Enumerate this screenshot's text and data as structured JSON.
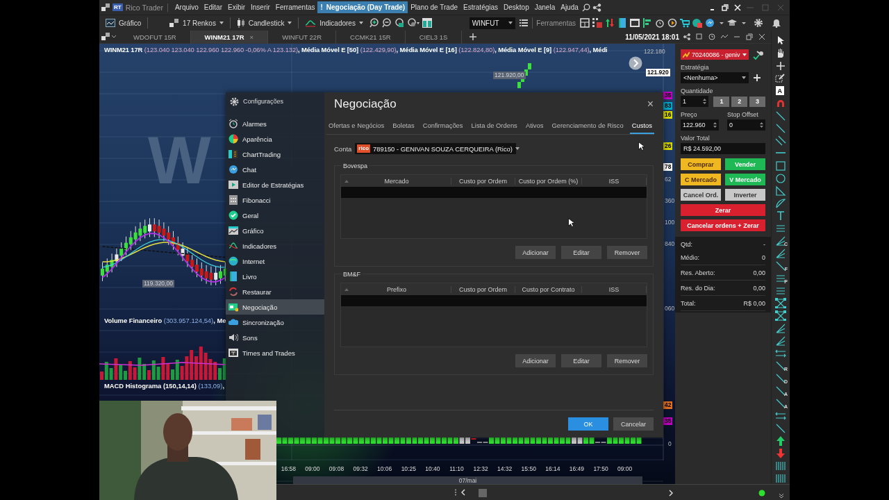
{
  "app": {
    "logo": "RT",
    "title": "Rico Trader"
  },
  "menu": [
    {
      "label": "Arquivo",
      "selected": false
    },
    {
      "label": "Editar",
      "selected": false
    },
    {
      "label": "Exibir",
      "selected": false
    },
    {
      "label": "Inserir",
      "selected": false
    },
    {
      "label": "Ferramentas",
      "selected": false
    },
    {
      "label": "Negociação (Day Trade)",
      "selected": true,
      "badge": "!"
    },
    {
      "label": "Plano de Trade",
      "selected": false
    },
    {
      "label": "Estratégias",
      "selected": false
    },
    {
      "label": "Desktop",
      "selected": false
    },
    {
      "label": "Janela",
      "selected": false
    },
    {
      "label": "Ajuda",
      "selected": false
    }
  ],
  "toolbar": {
    "chart_button": "Gráfico",
    "bricks": "17 Renkos",
    "style": "Candlestick",
    "indicators": "Indicadores",
    "symbol": "WINFUT",
    "tools_label": "Ferramentas"
  },
  "chart_tabs": [
    {
      "label": "WDOFUT 15R",
      "selected": false
    },
    {
      "label": "WINM21 17R",
      "selected": true,
      "close": "×"
    },
    {
      "label": "WINFUT 22R",
      "selected": false
    },
    {
      "label": "CCMK21 15R",
      "selected": false
    },
    {
      "label": "CIEL3 1S",
      "selected": false
    }
  ],
  "datetime": "11/05/2021 18:01",
  "chart": {
    "header": [
      {
        "text": "WINM21 17R ",
        "kind": "name"
      },
      {
        "text": "(123.040  123.040  122.960  122.960  -0,06%  A 123.132)",
        "kind": "value"
      },
      {
        "text": ", Média Móvel E [50] ",
        "kind": "name"
      },
      {
        "text": "(122.429,90)",
        "kind": "value"
      },
      {
        "text": ", Média Móvel E [16] ",
        "kind": "name"
      },
      {
        "text": "(122.824,80)",
        "kind": "value"
      },
      {
        "text": ", Média Móvel E [9] ",
        "kind": "name"
      },
      {
        "text": "(122.947,44)",
        "kind": "value"
      },
      {
        "text": ", Médi",
        "kind": "name"
      }
    ],
    "watermark": "W",
    "price_labels": [
      {
        "text": "122.180",
        "kind": "axis"
      },
      {
        "text": "121.920",
        "kind": "current"
      },
      {
        "text": "121.920,00",
        "kind": "marker"
      },
      {
        "text": "35",
        "kind": "badge",
        "color": "#c000c0"
      },
      {
        "text": "83",
        "kind": "badge",
        "color": "#00a8c8"
      },
      {
        "text": "16",
        "kind": "badge",
        "color": "#d8d800"
      },
      {
        "text": "26",
        "kind": "badge",
        "color": "#d8d800"
      },
      {
        "text": "78",
        "kind": "current"
      },
      {
        "text": "62",
        "kind": "axis"
      },
      {
        "text": "360",
        "kind": "axis"
      },
      {
        "text": "100",
        "kind": "axis"
      },
      {
        "text": "840",
        "kind": "axis"
      },
      {
        "text": "119.320,00",
        "kind": "marker"
      },
      {
        "text": "060",
        "kind": "axis"
      },
      {
        "text": "42",
        "kind": "badge",
        "color": "#e07020"
      },
      {
        "text": "35",
        "kind": "badge",
        "color": "#c000c0"
      },
      {
        "text": "0",
        "kind": "axis"
      }
    ],
    "volume_header": [
      {
        "text": "Volume Financeiro ",
        "kind": "name"
      },
      {
        "text": "(303.957.124,54)",
        "kind": "value"
      },
      {
        "text": ", Me",
        "kind": "name"
      }
    ],
    "macd_header": [
      {
        "text": "MACD Histograma (150,14,14) ",
        "kind": "name"
      },
      {
        "text": "(133,09)",
        "kind": "value"
      },
      {
        "text": ",",
        "kind": "name"
      }
    ],
    "time_labels": [
      "16:58",
      "09:00",
      "09:08",
      "09:32",
      "10:06",
      "10:25",
      "10:40",
      "11:10",
      "12:32",
      "14:32",
      "15:50",
      "16:14",
      "16:49",
      "17:50",
      "09:00"
    ],
    "date_band": "07/mai"
  },
  "dialog": {
    "sidebar_title": "Configurações",
    "sidebar": [
      {
        "label": "Alarmes",
        "selected": false
      },
      {
        "label": "Aparência",
        "selected": false
      },
      {
        "label": "ChartTrading",
        "selected": false
      },
      {
        "label": "Chat",
        "selected": false
      },
      {
        "label": "Editor de Estratégias",
        "selected": false
      },
      {
        "label": "Fibonacci",
        "selected": false
      },
      {
        "label": "Geral",
        "selected": false
      },
      {
        "label": "Gráfico",
        "selected": false
      },
      {
        "label": "Indicadores",
        "selected": false
      },
      {
        "label": "Internet",
        "selected": false
      },
      {
        "label": "Livro",
        "selected": false
      },
      {
        "label": "Restaurar",
        "selected": false
      },
      {
        "label": "Negociação",
        "selected": true
      },
      {
        "label": "Sincronização",
        "selected": false
      },
      {
        "label": "Sons",
        "selected": false
      },
      {
        "label": "Times and Trades",
        "selected": false
      }
    ],
    "title": "Negociação",
    "close": "×",
    "tabs": [
      {
        "label": "Ofertas e Negócios",
        "selected": false
      },
      {
        "label": "Boletas",
        "selected": false
      },
      {
        "label": "Confirmações",
        "selected": false
      },
      {
        "label": "Lista de Ordens",
        "selected": false
      },
      {
        "label": "Ativos",
        "selected": false
      },
      {
        "label": "Gerenciamento de Risco",
        "selected": false
      },
      {
        "label": "Custos",
        "selected": true
      }
    ],
    "account_label": "Conta",
    "account_logo": "rico",
    "account": "789150 - GENIVAN SOUZA CERQUEIRA (Rico)",
    "groups": [
      {
        "title": "Bovespa",
        "columns": [
          "Mercado",
          "Custo por Ordem",
          "Custo por Ordem (%)",
          "ISS"
        ],
        "buttons": [
          "Adicionar",
          "Editar",
          "Remover"
        ]
      },
      {
        "title": "BM&F",
        "columns": [
          "Prefixo",
          "Custo por Ordem",
          "Custo por Contrato",
          "ISS"
        ],
        "buttons": [
          "Adicionar",
          "Editar",
          "Remover"
        ]
      }
    ],
    "ok": "OK",
    "cancel": "Cancelar"
  },
  "order_panel": {
    "account": "70240086 - geniv",
    "strategy_label": "Estratégia",
    "strategy": "<Nenhuma>",
    "quantity_label": "Quantidade",
    "quantity": "1",
    "quick_quantities": [
      "1",
      "2",
      "3"
    ],
    "price_label": "Preço",
    "price": "122.960",
    "stop_label": "Stop Offset",
    "stop": "0",
    "total_label": "Valor Total",
    "total": "R$ 24.592,00",
    "buttons": [
      {
        "label": "Comprar",
        "kind": "buy"
      },
      {
        "label": "Vender",
        "kind": "sell"
      },
      {
        "label": "C Mercado",
        "kind": "buy"
      },
      {
        "label": "V Mercado",
        "kind": "sell"
      },
      {
        "label": "Cancel Ord.",
        "kind": "neutral"
      },
      {
        "label": "Inverter",
        "kind": "neutral"
      },
      {
        "label": "Zerar",
        "kind": "danger"
      },
      {
        "label": "Cancelar ordens + Zerar",
        "kind": "danger"
      }
    ],
    "summary": [
      {
        "label": "Qtd:",
        "value": "-"
      },
      {
        "label": "Médio:",
        "value": "0"
      },
      {
        "label": "Res. Aberto:",
        "value": "0,00"
      },
      {
        "label": "Res. do Dia:",
        "value": "0,00"
      },
      {
        "label": "Total:",
        "value": "R$ 0,00"
      }
    ]
  },
  "tools": [
    {
      "kind": "pointer"
    },
    {
      "kind": "hand"
    },
    {
      "kind": "plus"
    },
    {
      "kind": "edit"
    },
    {
      "kind": "textbox",
      "letter": "A"
    },
    {
      "kind": "magnet"
    },
    {
      "kind": "line"
    },
    {
      "kind": "line"
    },
    {
      "kind": "parallel"
    },
    {
      "kind": "hline"
    },
    {
      "kind": "rect"
    },
    {
      "kind": "circle"
    },
    {
      "kind": "triangle"
    },
    {
      "kind": "arc"
    },
    {
      "kind": "text"
    },
    {
      "kind": "lines"
    },
    {
      "kind": "fan",
      "letter": "C"
    },
    {
      "kind": "fan"
    },
    {
      "kind": "line",
      "letter": "F"
    },
    {
      "kind": "lines",
      "letter": "P"
    },
    {
      "kind": "lines"
    },
    {
      "kind": "nodes"
    },
    {
      "kind": "nodes"
    },
    {
      "kind": "fan"
    },
    {
      "kind": "fan"
    },
    {
      "kind": "arrows"
    },
    {
      "kind": "line",
      "letter": "R"
    },
    {
      "kind": "line",
      "letter": "D"
    },
    {
      "kind": "line",
      "letter": "A"
    },
    {
      "kind": "line",
      "letter": "A"
    },
    {
      "kind": "arrows"
    },
    {
      "kind": "line"
    },
    {
      "kind": "up"
    },
    {
      "kind": "down"
    },
    {
      "kind": "bars"
    },
    {
      "kind": "bars"
    }
  ]
}
